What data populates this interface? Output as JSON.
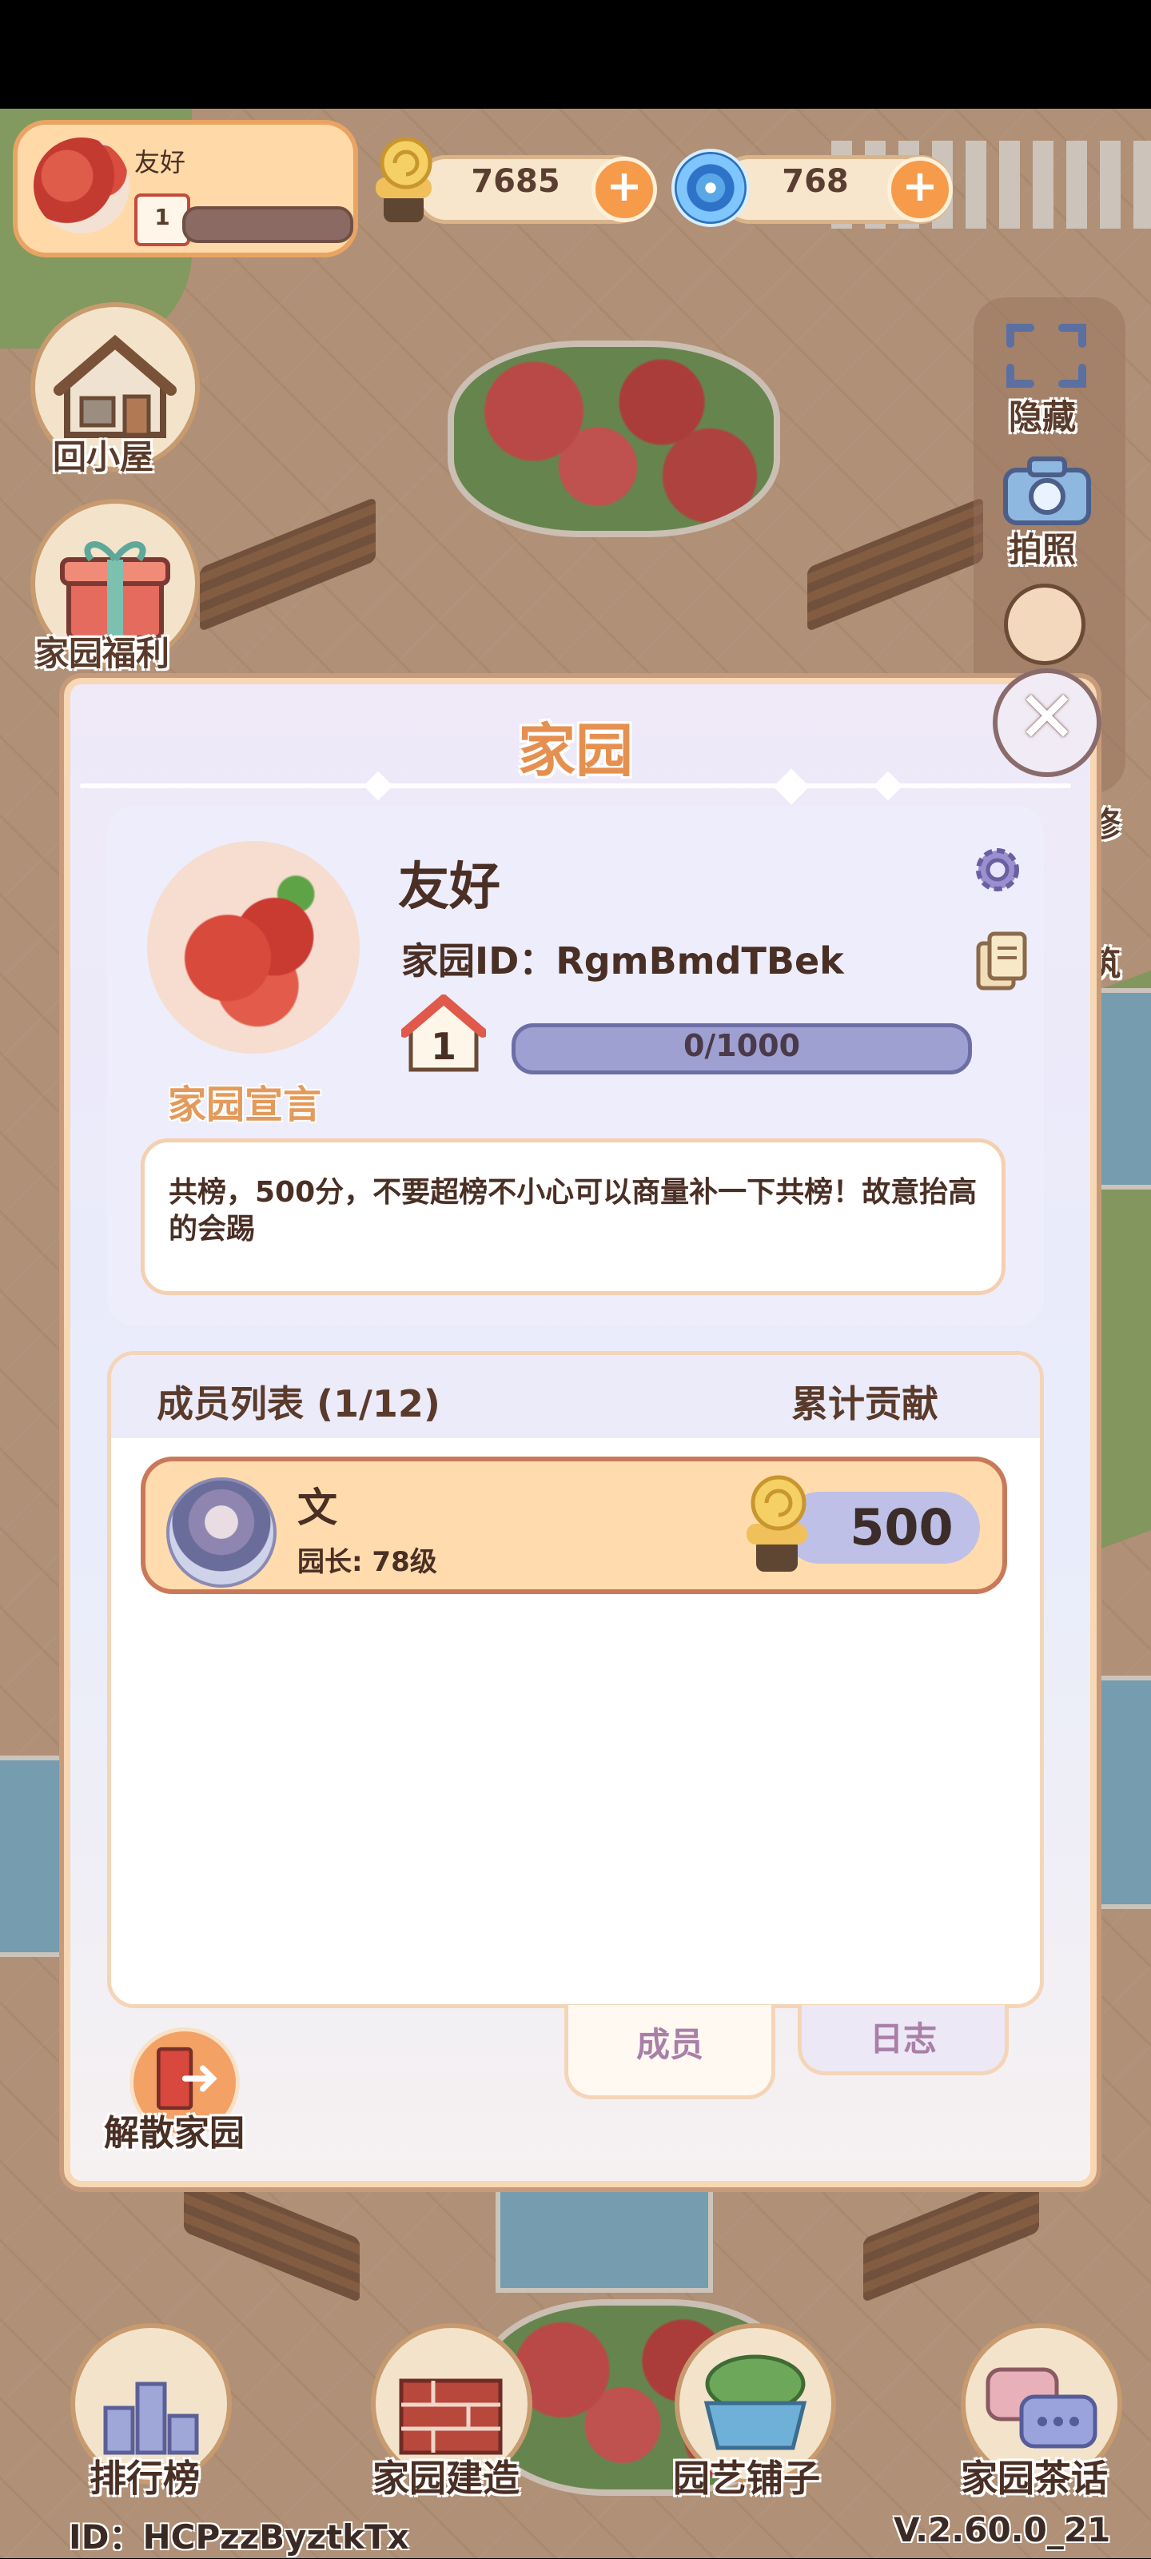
{
  "hud": {
    "player_name": "友好",
    "player_level": "1",
    "snail_coins": "7685",
    "swirl_gems": "768"
  },
  "left_buttons": {
    "home": "回小屋",
    "welfare": "家园福利"
  },
  "right_buttons": {
    "hide": "隐藏",
    "photo": "拍照",
    "repair_partial": "修",
    "build_partial": "筑"
  },
  "modal": {
    "title": "家园",
    "home_name": "友好",
    "home_id": "家园ID：RgmBmdTBek",
    "level": "1",
    "progress_text": "0/1000",
    "progress_fraction": 0.0,
    "declaration_label": "家园宣言",
    "declaration_text": "共榜，500分，不要超榜不小心可以商量补一下共榜！故意抬高的会踢"
  },
  "members": {
    "title": "成员列表 (1/12)",
    "contribution_title": "累计贡献",
    "rows": [
      {
        "name": "文",
        "role": "园长: 78级",
        "contribution": "500"
      }
    ]
  },
  "tabs": {
    "members": "成员",
    "log": "日志"
  },
  "dissolve": "解散家园",
  "bottom_nav": [
    {
      "label": "排行榜"
    },
    {
      "label": "家园建造"
    },
    {
      "label": "园艺铺子"
    },
    {
      "label": "家园茶话"
    }
  ],
  "footer": {
    "id": "ID：HCPzzByztkTx",
    "version": "V.2.60.0_21"
  },
  "colors": {
    "accent_orange": "#e59050",
    "modal_border": "#f7d7b4",
    "member_row": "#ffdbad",
    "progress_bar": "#9fa0d2"
  }
}
